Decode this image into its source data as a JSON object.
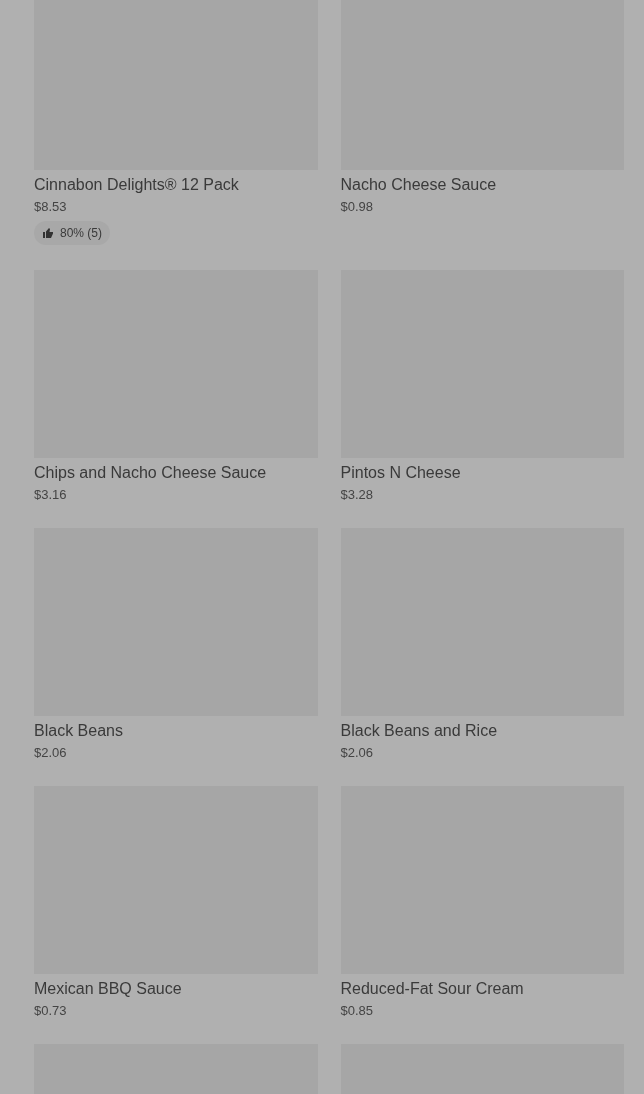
{
  "products": [
    {
      "kind": "top_cut",
      "name": "Cinnabon Delights® 12 Pack",
      "price": "$8.53",
      "rating": "80% (5)"
    },
    {
      "kind": "top_cut",
      "name": "Nacho Cheese Sauce",
      "price": "$0.98"
    },
    {
      "kind": "full",
      "name": "Chips and Nacho Cheese Sauce",
      "price": "$3.16"
    },
    {
      "kind": "full",
      "name": "Pintos N Cheese",
      "price": "$3.28"
    },
    {
      "kind": "full",
      "name": "Black Beans",
      "price": "$2.06"
    },
    {
      "kind": "full",
      "name": "Black Beans and Rice",
      "price": "$2.06"
    },
    {
      "kind": "full",
      "name": "Mexican BBQ Sauce",
      "price": "$0.73"
    },
    {
      "kind": "full",
      "name": "Reduced-Fat Sour Cream",
      "price": "$0.85"
    },
    {
      "kind": "bottom_cut"
    },
    {
      "kind": "bottom_cut"
    }
  ]
}
